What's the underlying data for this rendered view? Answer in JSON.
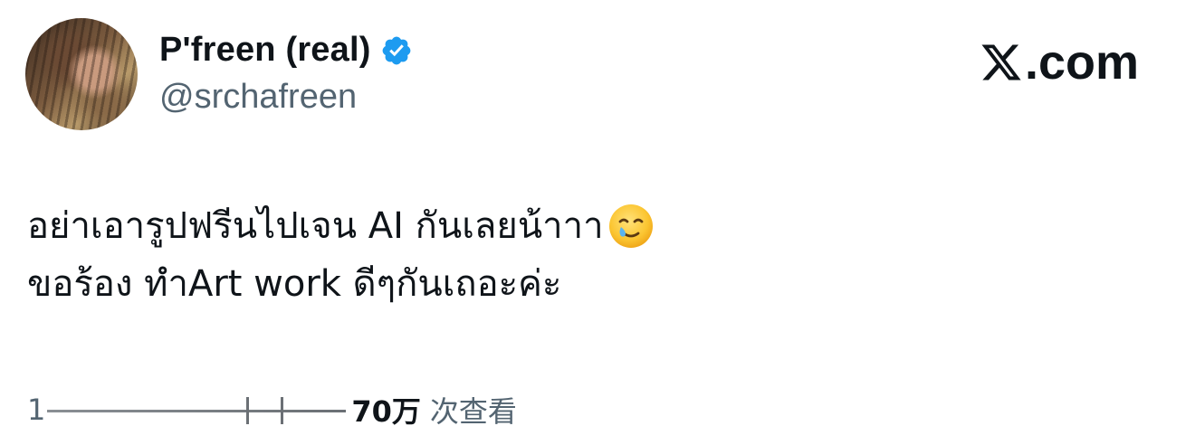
{
  "author": {
    "display_name": "P'freen (real)",
    "handle": "@srchafreen",
    "verified": true,
    "avatar_icon": "profile-photo"
  },
  "brand": {
    "label": ".com",
    "icon": "x-logo-icon"
  },
  "tweet": {
    "lines": [
      "อย่าเอารูปฟรีนไปเจน AI กันเลยน้าาา",
      "ขอร้อง ทำArt work ดีๆกันเถอะค่ะ"
    ],
    "emoji": "smiling-face-with-tear-icon"
  },
  "footer": {
    "lead": "1",
    "views": "70万",
    "views_suffix": "次查看"
  },
  "colors": {
    "text": "#0f1419",
    "muted": "#536471",
    "verified": "#1d9bf0"
  }
}
